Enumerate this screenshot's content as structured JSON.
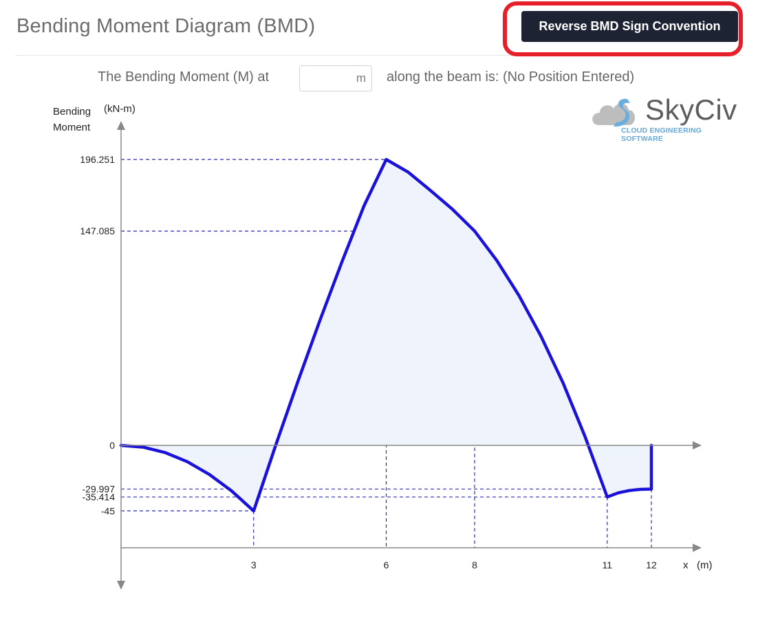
{
  "header": {
    "title": "Bending Moment Diagram (BMD)",
    "reverse_button_label": "Reverse BMD Sign Convention"
  },
  "query": {
    "prefix": "The Bending Moment (M) at",
    "input_value": "",
    "unit": "m",
    "suffix": "along the beam is: (No Position Entered)"
  },
  "logo": {
    "name": "SkyCiv",
    "tagline": "CLOUD ENGINEERING SOFTWARE"
  },
  "colors": {
    "curve": "#1a12d9",
    "fill": "#eef3fc",
    "axis": "#888888",
    "guide": "#2b2bb8",
    "button_bg": "#1d2332",
    "highlight": "#e5202a"
  },
  "chart_data": {
    "type": "area",
    "ylabel_line1": "Bending",
    "ylabel_line2": "Moment",
    "yunit": "(kN-m)",
    "xlabel": "x",
    "xunit": "(m)",
    "x_ticks": [
      "3",
      "6",
      "8",
      "11",
      "12"
    ],
    "y_ticks": [
      "196.251",
      "147.085",
      "0",
      "-29.997",
      "-35.414",
      "-45"
    ],
    "points": [
      {
        "x": 0,
        "y": 0
      },
      {
        "x": 0.5,
        "y": -1.25
      },
      {
        "x": 1,
        "y": -5
      },
      {
        "x": 1.5,
        "y": -11.25
      },
      {
        "x": 2,
        "y": -20
      },
      {
        "x": 2.5,
        "y": -31.25
      },
      {
        "x": 3,
        "y": -45
      },
      {
        "x": 3.5,
        "y": 0.2
      },
      {
        "x": 4,
        "y": 43.8
      },
      {
        "x": 4.5,
        "y": 85.8
      },
      {
        "x": 5,
        "y": 126.2
      },
      {
        "x": 5.5,
        "y": 164.6
      },
      {
        "x": 6,
        "y": 196.251
      },
      {
        "x": 6.5,
        "y": 187.5
      },
      {
        "x": 7,
        "y": 175
      },
      {
        "x": 7.5,
        "y": 162
      },
      {
        "x": 8,
        "y": 147.085
      },
      {
        "x": 8.5,
        "y": 127
      },
      {
        "x": 9,
        "y": 103
      },
      {
        "x": 9.5,
        "y": 75
      },
      {
        "x": 10,
        "y": 43
      },
      {
        "x": 10.5,
        "y": 6
      },
      {
        "x": 11,
        "y": -35.414
      },
      {
        "x": 11.25,
        "y": -32.6
      },
      {
        "x": 11.5,
        "y": -31
      },
      {
        "x": 11.75,
        "y": -30.2
      },
      {
        "x": 12,
        "y": -29.997
      },
      {
        "x": 12,
        "y": 0
      }
    ],
    "guides": [
      {
        "x": 3,
        "y": -45
      },
      {
        "x": 6,
        "y": 196.251
      },
      {
        "x": 8,
        "y": 147.085
      },
      {
        "x": 11,
        "y": -35.414
      },
      {
        "x": 12,
        "y": -29.997
      }
    ],
    "xlim": [
      0,
      12
    ],
    "ylim": [
      -45,
      196.251
    ]
  }
}
